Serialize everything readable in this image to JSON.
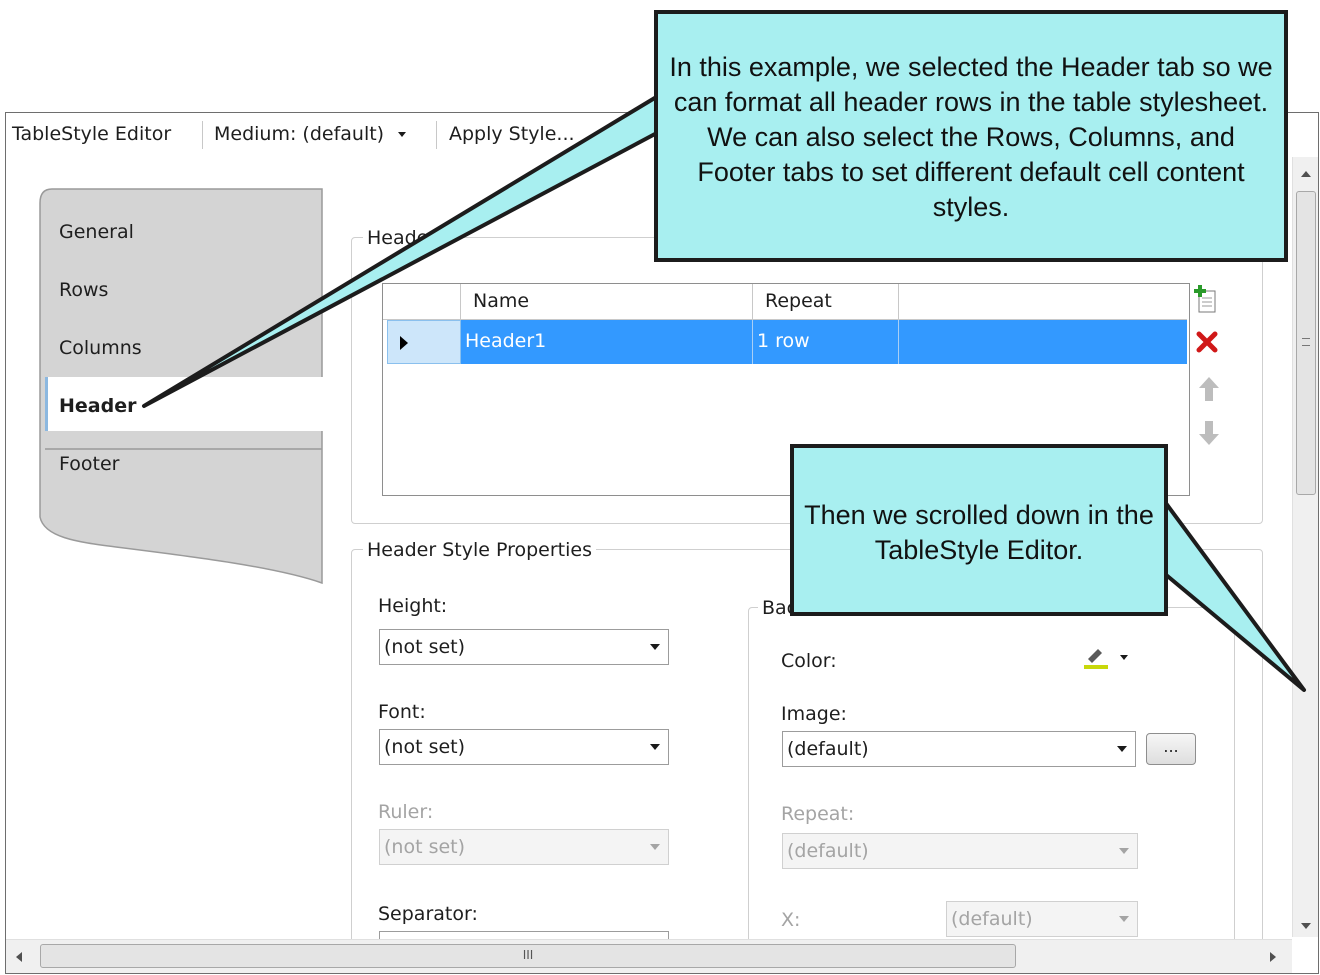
{
  "toolbar": {
    "title": "TableStyle Editor",
    "medium": "Medium: (default)",
    "apply": "Apply Style..."
  },
  "tabs": [
    {
      "label": "General"
    },
    {
      "label": "Rows"
    },
    {
      "label": "Columns"
    },
    {
      "label": "Header",
      "selected": true
    },
    {
      "label": "Footer"
    }
  ],
  "header_rows_group": {
    "label": "Heade",
    "columns": [
      "Name",
      "Repeat"
    ],
    "rows": [
      {
        "name": "Header1",
        "repeat": "1 row"
      }
    ]
  },
  "header_style": {
    "label": "Header Style Properties",
    "height": {
      "label": "Height:",
      "value": "(not set)"
    },
    "font": {
      "label": "Font:",
      "value": "(not set)"
    },
    "ruler": {
      "label": "Ruler:",
      "value": "(not set)"
    },
    "separator": {
      "label": "Separator:"
    }
  },
  "background": {
    "label": "Bac",
    "color": {
      "label": "Color:"
    },
    "image": {
      "label": "Image:",
      "value": "(default)",
      "browse": "..."
    },
    "repeat": {
      "label": "Repeat:",
      "value": "(default)"
    },
    "x": {
      "label": "X:",
      "value": "(default)"
    }
  },
  "hscroll": {
    "grip": "III"
  },
  "callouts": {
    "tab_note": "In this example, we selected the Header tab so we can format all header rows in the table stylesheet. We can also select the Rows, Columns, and Footer tabs to set different default cell content styles.",
    "scroll_note": "Then we scrolled down in the TableStyle Editor."
  },
  "colors": {
    "callout_fill": "#a8eff0",
    "selection": "#3399ff",
    "delete_icon": "#d01818",
    "add_icon": "#2a9a2a"
  }
}
